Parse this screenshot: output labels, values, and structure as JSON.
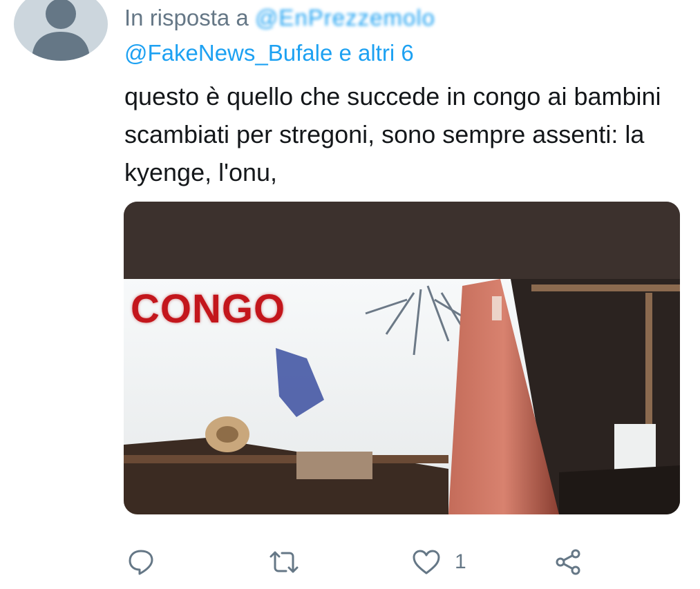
{
  "tweet": {
    "reply_prefix": "In risposta a",
    "reply_handle_blurred": "@EnPrezzemolo",
    "reply_line2": "@FakeNews_Bufale e altri 6",
    "text": "questo è quello che succede in congo ai bambini scambiati per stregoni, sono sempre assenti: la kyenge, l'onu,",
    "media": {
      "overlay_text": "CONGO"
    }
  },
  "actions": {
    "reply_icon": "reply-icon",
    "retweet_icon": "retweet-icon",
    "like_icon": "heart-icon",
    "like_count": "1",
    "share_icon": "share-icon"
  },
  "colors": {
    "link": "#1da1f2",
    "secondary": "#657786",
    "text": "#14171a",
    "avatar_bg": "#ccd6dd",
    "overlay_red": "#c3161c"
  }
}
